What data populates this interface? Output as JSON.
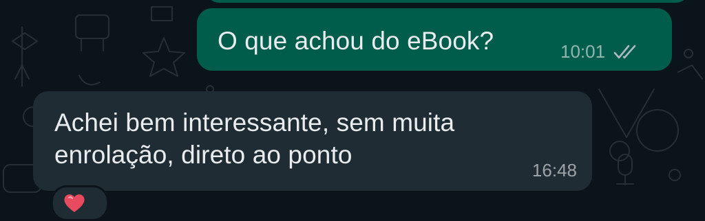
{
  "chat": {
    "messages": [
      {
        "direction": "outgoing",
        "text": "O que achou do eBook?",
        "time": "10:01",
        "status_icon": "double-check-icon"
      },
      {
        "direction": "incoming",
        "lines": [
          "Achei bem interessante, sem muita",
          "enrolação, direto ao ponto"
        ],
        "time": "16:48",
        "reaction": "heart"
      }
    ]
  },
  "colors": {
    "background": "#0b141a",
    "outgoing_bubble": "#005c4b",
    "incoming_bubble": "#202c33",
    "text": "#e9edef",
    "meta": "#8696a0",
    "reaction_heart": "#e84a5f"
  }
}
